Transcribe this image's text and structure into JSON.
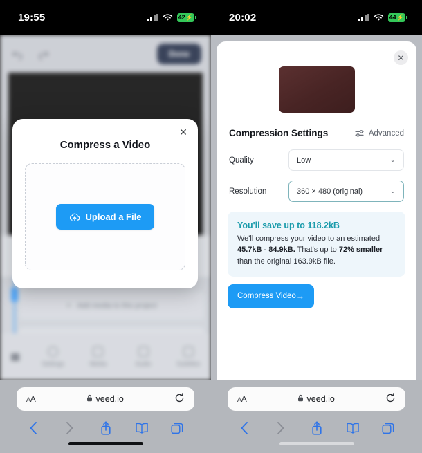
{
  "left": {
    "status": {
      "time": "19:55",
      "battery": "42",
      "charging": true,
      "wifi_icon": "wifi-icon",
      "signal_icon": "cellular-signal-icon"
    },
    "editor": {
      "undo_icon": "undo-arrow-icon",
      "redo_icon": "redo-arrow-icon",
      "done_label": "Done",
      "timeline_hint": "Add media to this project",
      "tabs": [
        {
          "label": "Settings",
          "icon": "gear-icon"
        },
        {
          "label": "Media",
          "icon": "media-icon"
        },
        {
          "label": "Audio",
          "icon": "audio-icon"
        },
        {
          "label": "Subtitles",
          "icon": "subtitles-icon"
        }
      ],
      "menu_icon": "menu-grid-icon"
    },
    "modal": {
      "title": "Compress a Video",
      "close_icon": "close-icon",
      "upload_label": "Upload a File",
      "upload_icon": "cloud-upload-icon",
      "accent": "#1d9bf5"
    },
    "safari": {
      "text_size_label": "AA",
      "url": "veed.io",
      "lock_icon": "lock-icon",
      "reload_icon": "reload-icon",
      "back_icon": "chevron-left-icon",
      "forward_icon": "chevron-right-icon",
      "share_icon": "share-icon",
      "bookmarks_icon": "book-icon",
      "tabs_icon": "tabs-icon"
    }
  },
  "right": {
    "status": {
      "time": "20:02",
      "battery": "44",
      "charging": true,
      "wifi_icon": "wifi-icon",
      "signal_icon": "cellular-signal-icon"
    },
    "sheet": {
      "close_icon": "close-icon",
      "thumbnail_name": "video-thumbnail",
      "section_title": "Compression Settings",
      "advanced_label": "Advanced",
      "advanced_icon": "sliders-icon",
      "fields": [
        {
          "label": "Quality",
          "value": "Low",
          "focused": false
        },
        {
          "label": "Resolution",
          "value": "360 × 480 (original)",
          "focused": true
        }
      ],
      "info": {
        "headline": "You'll save up to 118.2kB",
        "line1_pre": "We'll compress your video to an estimated ",
        "line1_bold": "45.7kB - 84.9kB.",
        "line2_pre": " That's up to ",
        "line2_bold": "72% smaller",
        "line3": " than the original 163.9kB file.",
        "accent": "#1a9bab",
        "background": "#eef6fb"
      },
      "cta_label": "Compress Video",
      "cta_arrow": "→",
      "accent": "#1d9bf5"
    },
    "safari": {
      "text_size_label": "AA",
      "url": "veed.io",
      "lock_icon": "lock-icon",
      "reload_icon": "reload-icon",
      "back_icon": "chevron-left-icon",
      "forward_icon": "chevron-right-icon",
      "share_icon": "share-icon",
      "bookmarks_icon": "book-icon",
      "tabs_icon": "tabs-icon"
    }
  }
}
